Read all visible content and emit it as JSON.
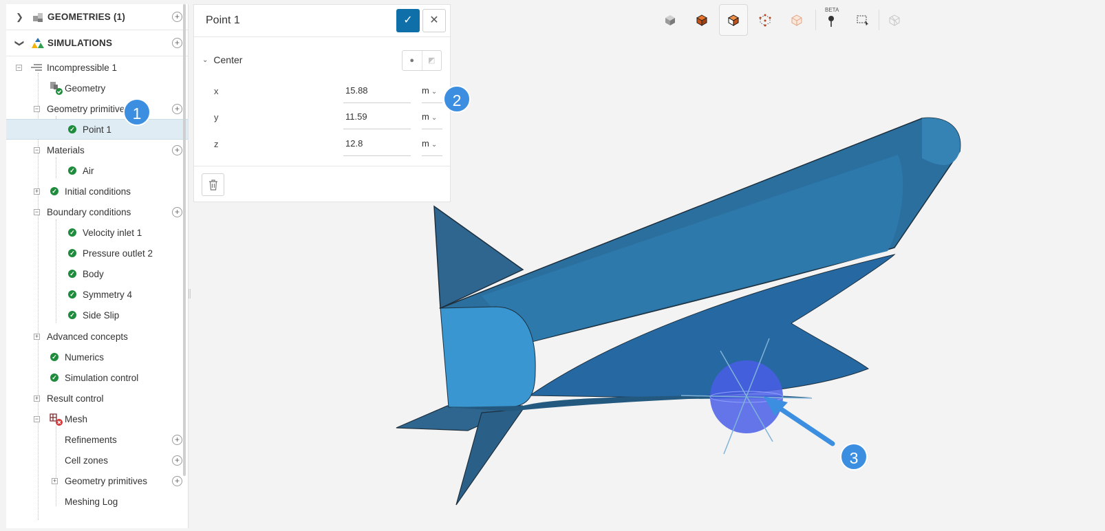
{
  "sidebar": {
    "geometries": {
      "label": "GEOMETRIES (1)",
      "icon": "cubes-icon"
    },
    "simulations": {
      "label": "SIMULATIONS",
      "icon": "simulation-icon"
    },
    "tree": {
      "incompressible": "Incompressible 1",
      "geometry": "Geometry",
      "geometry_primitives": "Geometry primitives",
      "point1": "Point 1",
      "materials": "Materials",
      "air": "Air",
      "initial_conditions": "Initial conditions",
      "boundary_conditions": "Boundary conditions",
      "velocity_inlet": "Velocity inlet 1",
      "pressure_outlet": "Pressure outlet 2",
      "body": "Body",
      "symmetry": "Symmetry 4",
      "side_slip": "Side Slip",
      "advanced_concepts": "Advanced concepts",
      "numerics": "Numerics",
      "simulation_control": "Simulation control",
      "result_control": "Result control",
      "mesh": "Mesh",
      "refinements": "Refinements",
      "cell_zones": "Cell zones",
      "mesh_geometry_primitives": "Geometry primitives",
      "meshing_log": "Meshing Log"
    }
  },
  "panel": {
    "title": "Point 1",
    "section": "Center",
    "coords": [
      {
        "label": "x",
        "value": "15.88",
        "unit": "m"
      },
      {
        "label": "y",
        "value": "11.59",
        "unit": "m"
      },
      {
        "label": "z",
        "value": "12.8",
        "unit": "m"
      }
    ]
  },
  "toolbar": {
    "beta": "BETA"
  },
  "callouts": {
    "one": "1",
    "two": "2",
    "three": "3"
  },
  "colors": {
    "accent": "#0f6fa8",
    "callout": "#3b8ee0",
    "model": "#2a6f9e",
    "check": "#1e8c3c"
  }
}
